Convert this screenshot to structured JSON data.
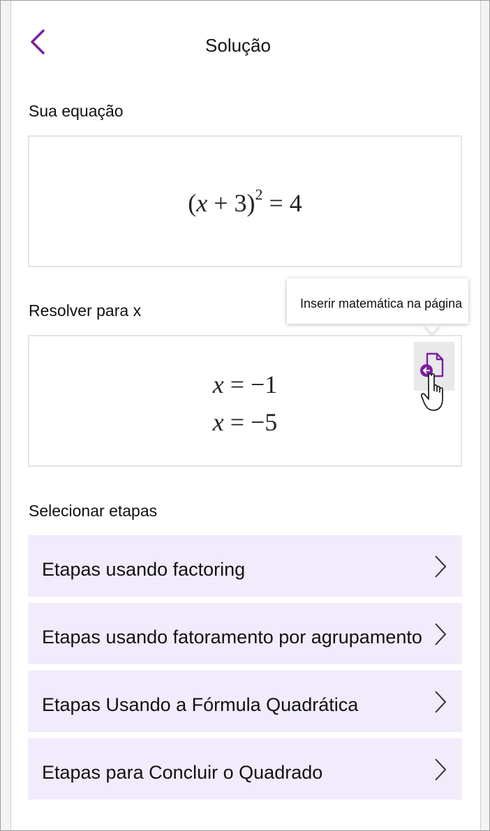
{
  "header": {
    "title": "Solução",
    "back_icon": "chevron-left-icon"
  },
  "equation_section": {
    "label": "Sua equação",
    "equation": {
      "open": "(",
      "var": "x",
      "plus": " + 3)",
      "exp": "2",
      "rhs": " = 4"
    }
  },
  "solve_section": {
    "label": "Resolver para x",
    "solutions": [
      {
        "var": "x",
        "rhs": " = −1"
      },
      {
        "var": "x",
        "rhs": " = −5"
      }
    ],
    "insert_tooltip": "Inserir matemática na página",
    "insert_icon": "insert-math-icon"
  },
  "steps_section": {
    "label": "Selecionar etapas",
    "items": [
      {
        "label": "Etapas usando factoring"
      },
      {
        "label": "Etapas usando fatoramento por agrupamento"
      },
      {
        "label": "Etapas Usando a Fórmula Quadrática"
      },
      {
        "label": "Etapas para Concluir o Quadrado"
      }
    ]
  },
  "colors": {
    "accent": "#7b1fa2",
    "step_bg": "#f1ebfb",
    "box_border": "#e4e4e4"
  }
}
